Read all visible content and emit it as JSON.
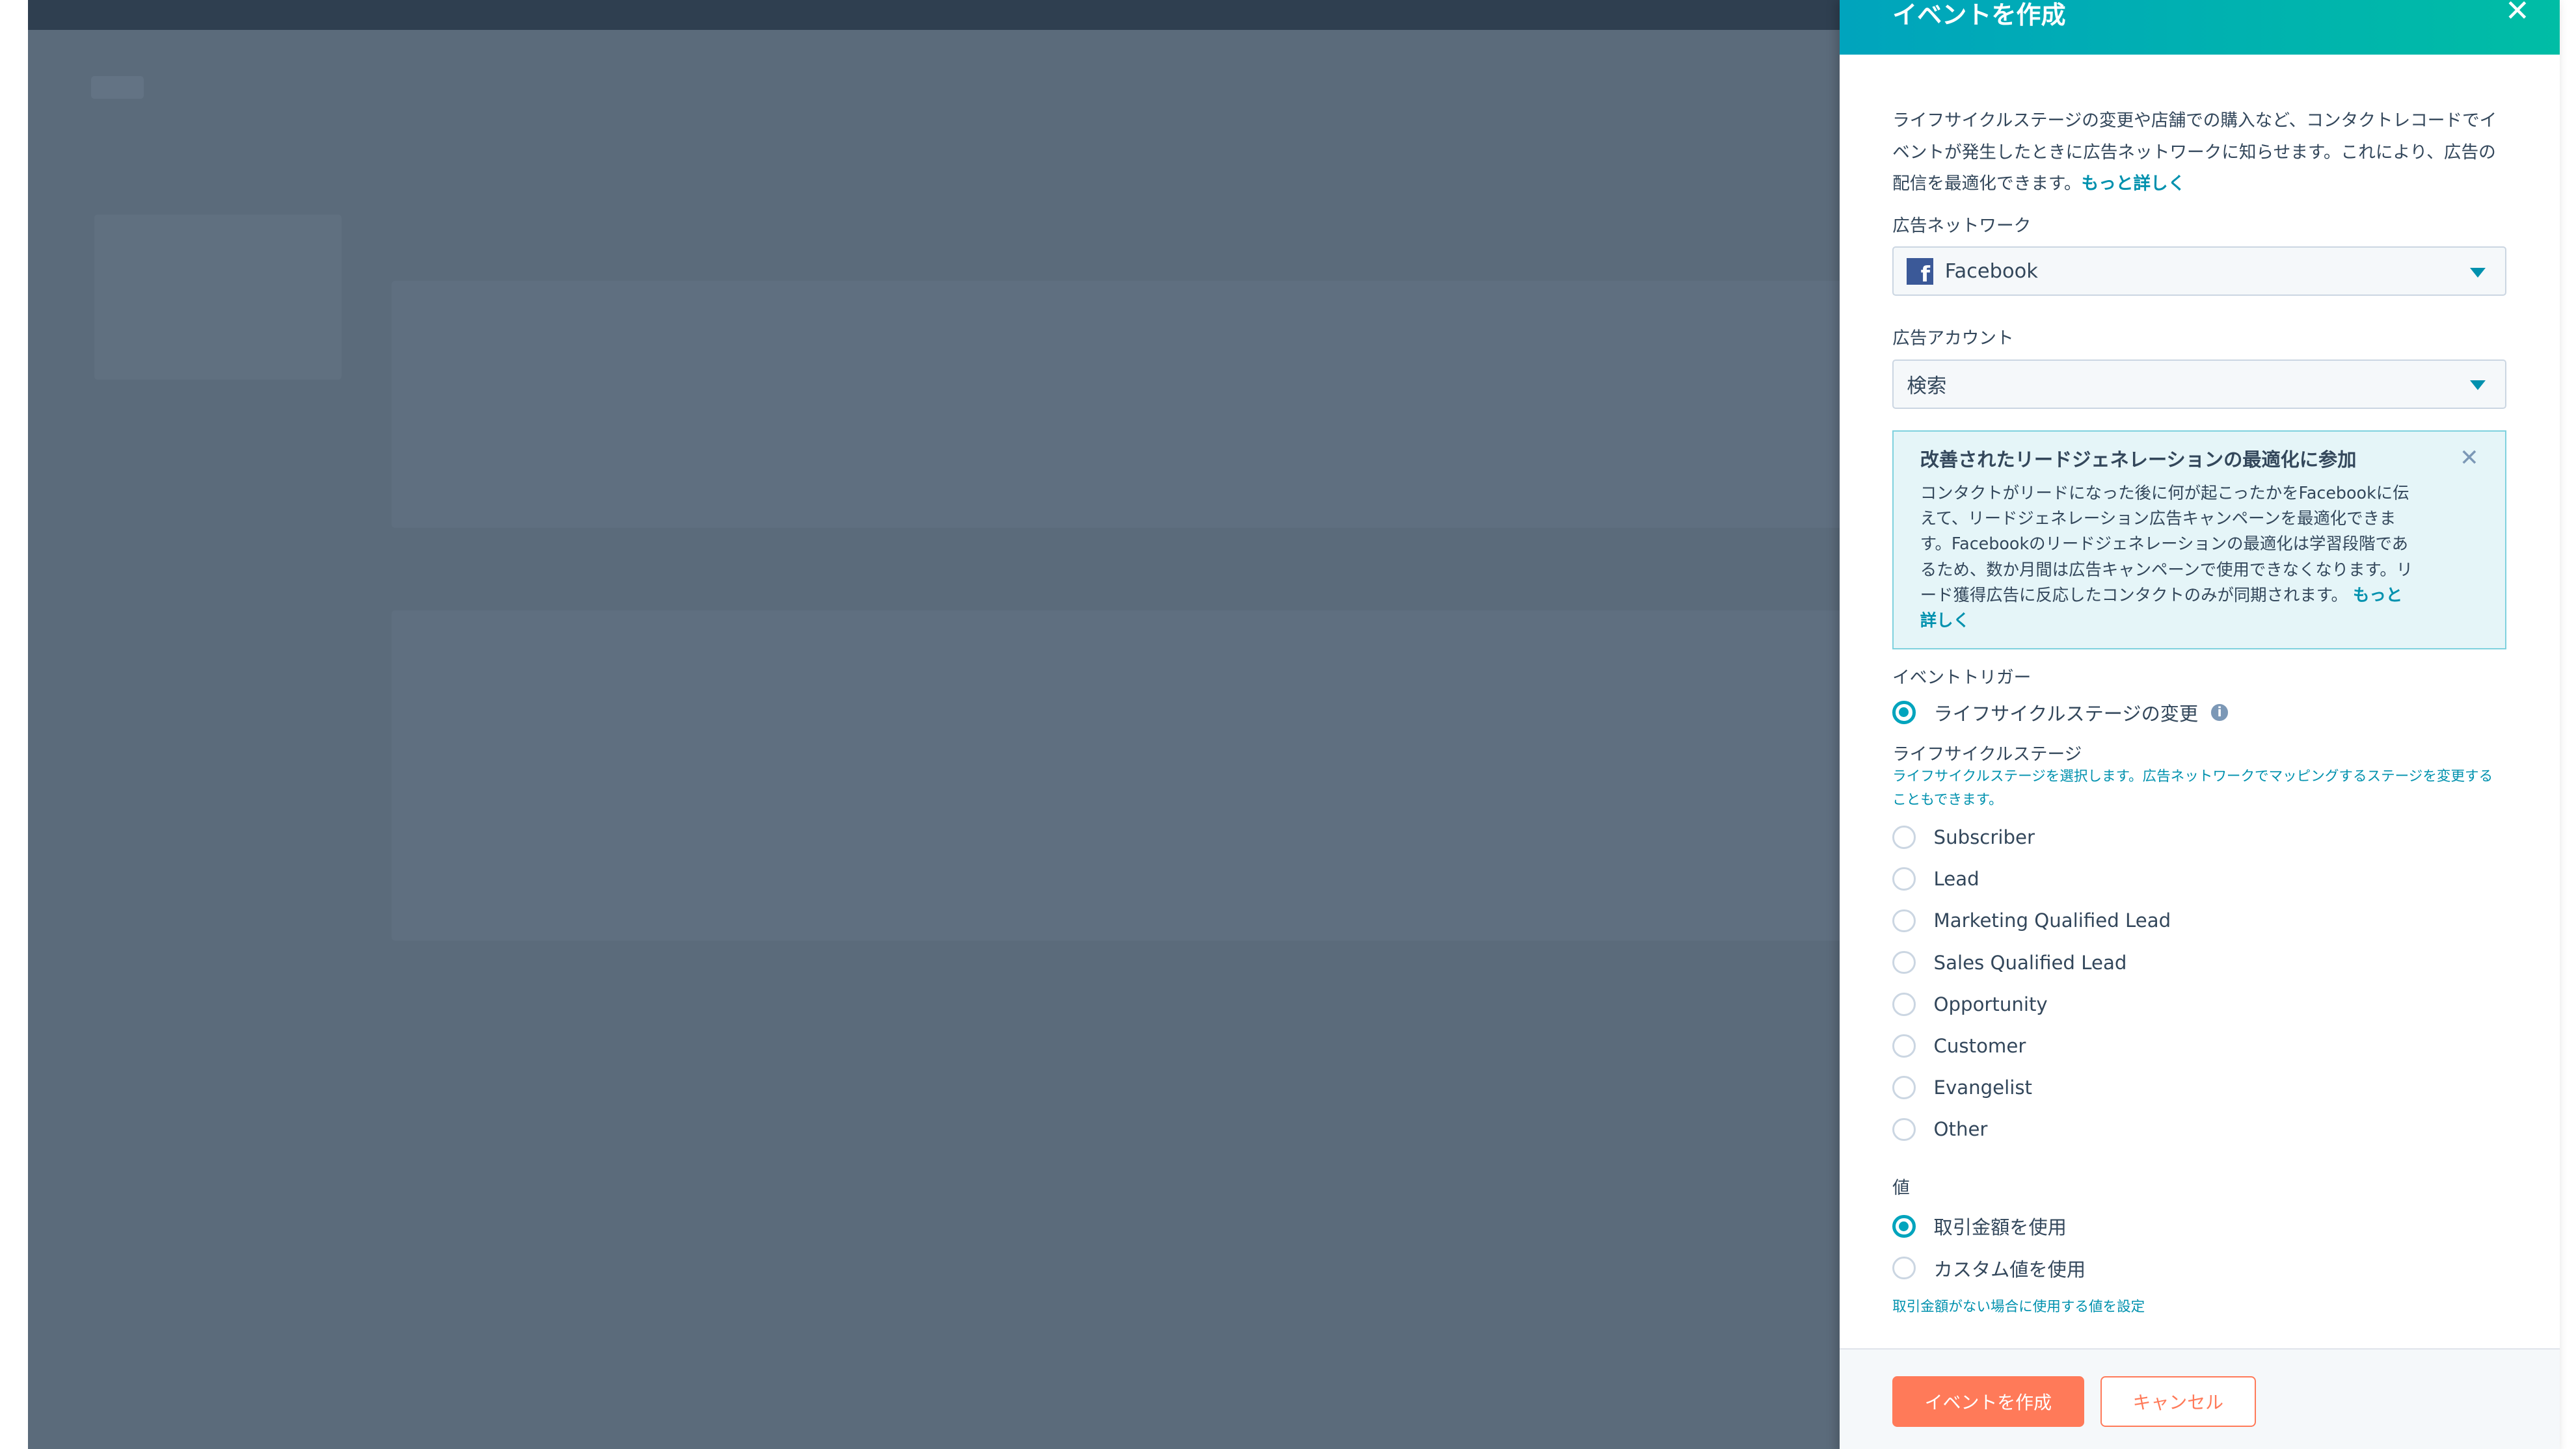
{
  "panel": {
    "title": "イベントを作成",
    "description": "ライフサイクルステージの変更や店舗での購入など、コンタクトレコードでイベントが発生したときに広告ネットワークに知らせます。これにより、広告の配信を最適化できます。",
    "learn_more": "もっと詳しく",
    "network_label": "広告ネットワーク",
    "network_value": "Facebook",
    "account_label": "広告アカウント",
    "account_value": "検索",
    "alert": {
      "title": "改善されたリードジェネレーションの最適化に参加",
      "body": "コンタクトがリードになった後に何が起こったかをFacebookに伝えて、リードジェネレーション広告キャンペーンを最適化できます。Facebookのリードジェネレーションの最適化は学習段階であるため、数か月間は広告キャンペーンで使用できなくなります。リード獲得広告に反応したコンタクトのみが同期されます。",
      "learn_more": "もっと詳しく"
    },
    "trigger_label": "イベントトリガー",
    "trigger_option": "ライフサイクルステージの変更",
    "stage_label": "ライフサイクルステージ",
    "stage_help": "ライフサイクルステージを選択します。広告ネットワークでマッピングするステージを変更することもできます。",
    "stages": [
      "Subscriber",
      "Lead",
      "Marketing Qualified Lead",
      "Sales Qualified Lead",
      "Opportunity",
      "Customer",
      "Evangelist",
      "Other"
    ],
    "value_label": "値",
    "value_options": [
      {
        "label": "取引金額を使用",
        "selected": true
      },
      {
        "label": "カスタム値を使用",
        "selected": false
      }
    ],
    "value_help": "取引金額がない場合に使用する値を設定",
    "create_button": "イベントを作成",
    "cancel_button": "キャンセル"
  },
  "colors": {
    "accent": "#00a4bd",
    "primary_button": "#ff7a59",
    "link": "#0091ae"
  }
}
